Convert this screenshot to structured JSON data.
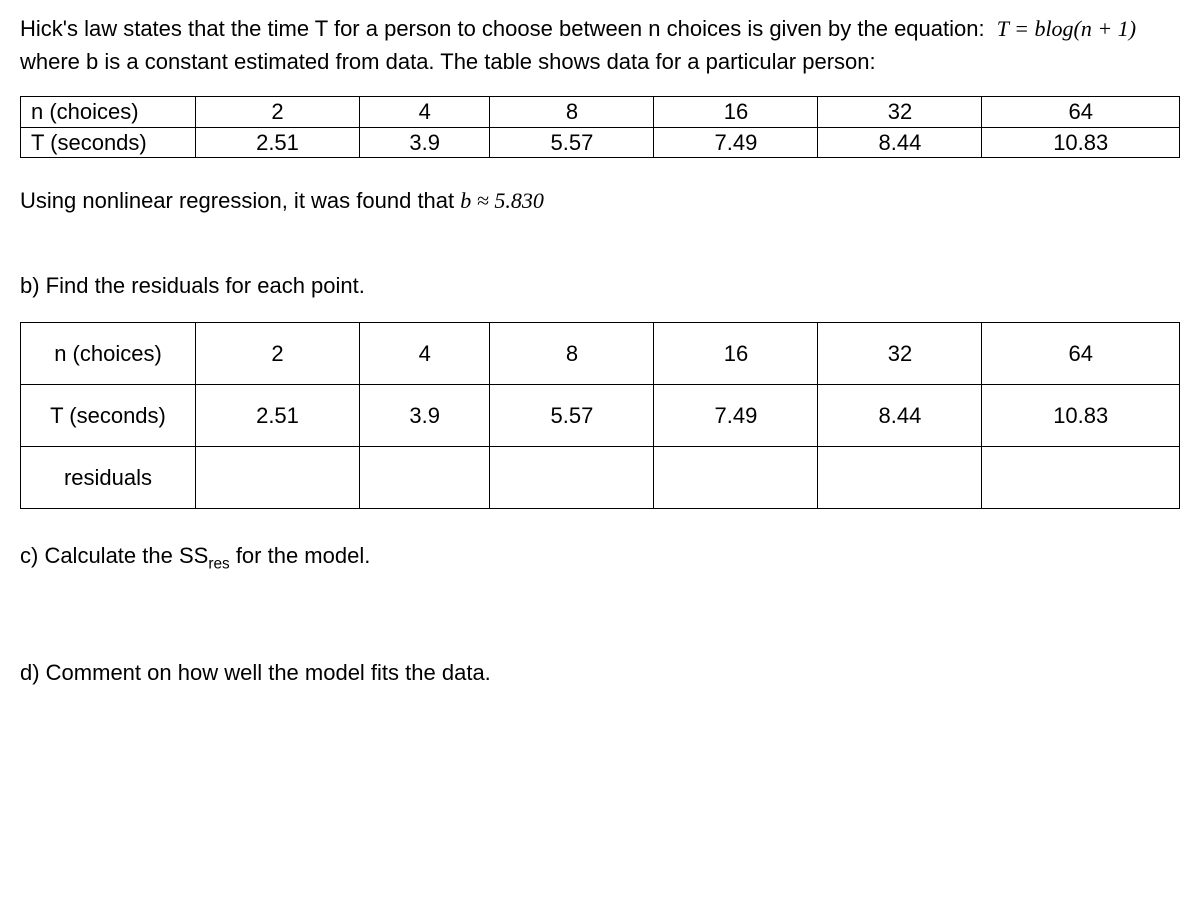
{
  "intro": {
    "part1": "Hick's law states that the time T for a person to choose between n choices is given by the equation:",
    "equation": "T = b log(n + 1)",
    "part2": " where b is a constant estimated from data. The table shows data for a particular person:"
  },
  "table1": {
    "rows": [
      {
        "label": "n (choices)",
        "cells": [
          "2",
          "4",
          "8",
          "16",
          "32",
          "64"
        ]
      },
      {
        "label": "T (seconds)",
        "cells": [
          "2.51",
          "3.9",
          "5.57",
          "7.49",
          "8.44",
          "10.83"
        ]
      }
    ]
  },
  "regression_text": {
    "part1": "Using nonlinear regression, it was found that ",
    "b_approx": "b ≈ 5.830"
  },
  "partB": {
    "prompt": "b) Find the residuals for each point.",
    "rows": [
      {
        "label": "n (choices)",
        "cells": [
          "2",
          "4",
          "8",
          "16",
          "32",
          "64"
        ]
      },
      {
        "label": "T (seconds)",
        "cells": [
          "2.51",
          "3.9",
          "5.57",
          "7.49",
          "8.44",
          "10.83"
        ]
      },
      {
        "label": "residuals",
        "cells": [
          "",
          "",
          "",
          "",
          "",
          ""
        ]
      }
    ]
  },
  "partC": {
    "prefix": "c) Calculate the SS",
    "sub": "res",
    "suffix": " for the model."
  },
  "partD": "d) Comment on how well the model fits the data."
}
